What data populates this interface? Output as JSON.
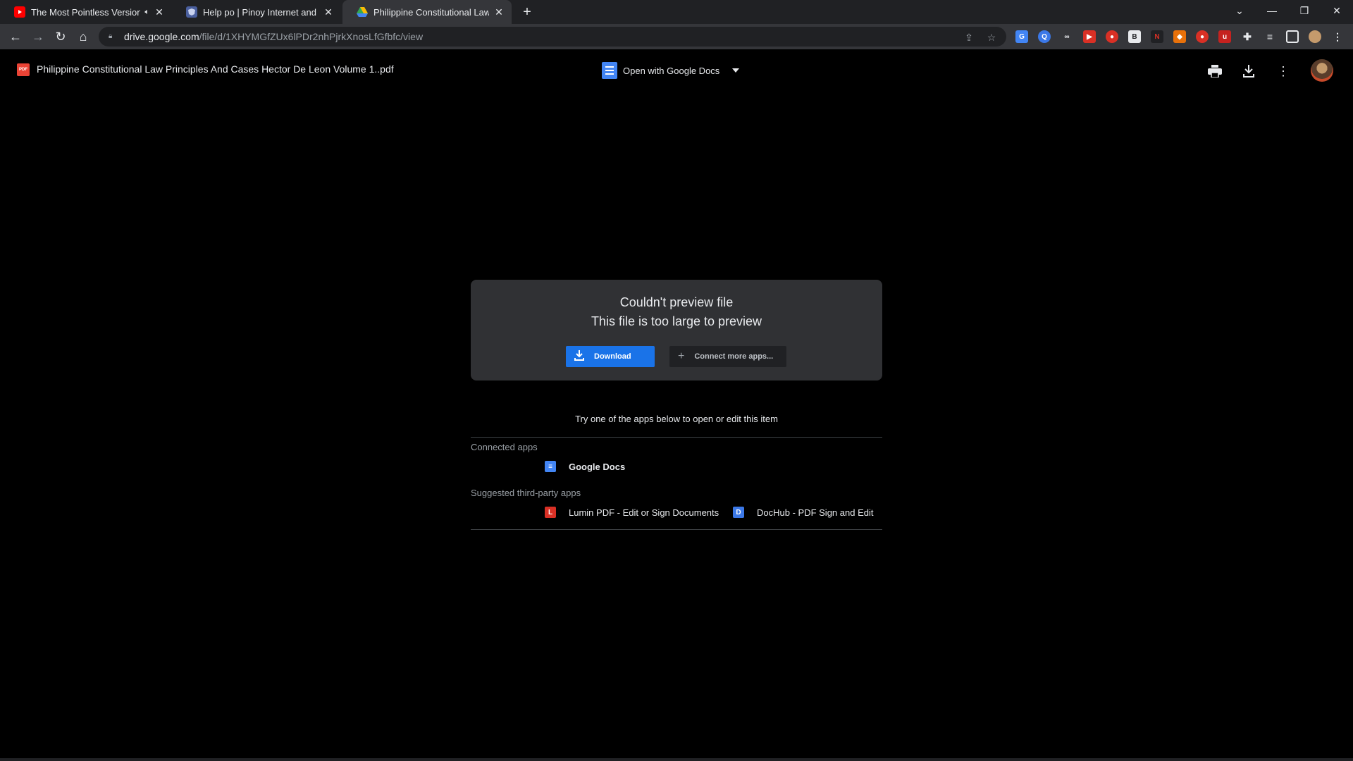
{
  "browser": {
    "tabs": [
      {
        "title": "The Most Pointless Version o",
        "favicon": "youtube-icon",
        "audio": true,
        "active": false
      },
      {
        "title": "Help po | Pinoy Internet and Tec",
        "favicon": "forum-icon",
        "audio": false,
        "active": false
      },
      {
        "title": "Philippine Constitutional Law Prin",
        "favicon": "google-drive-icon",
        "audio": false,
        "active": true
      }
    ],
    "url_host": "drive.google.com",
    "url_path": "/file/d/1XHYMGfZUx6lPDr2nhPjrkXnosLfGfbfc/view"
  },
  "viewer": {
    "file_title": "Philippine Constitutional Law Principles And Cases Hector De Leon Volume 1..pdf",
    "file_badge": "PDF",
    "open_with_label": "Open with Google Docs"
  },
  "error_card": {
    "line1": "Couldn't preview file",
    "line2": "This file is too large to preview",
    "download_label": "Download",
    "connect_label": "Connect more apps..."
  },
  "apps": {
    "hint": "Try one of the apps below to open or edit this item",
    "connected_label": "Connected apps",
    "connected": [
      {
        "name": "Google Docs"
      }
    ],
    "suggested_label": "Suggested third-party apps",
    "suggested": [
      {
        "name": "Lumin PDF - Edit or Sign Documents"
      },
      {
        "name": "DocHub - PDF Sign and Edit"
      }
    ]
  },
  "colors": {
    "background": "#000000",
    "card": "#303134",
    "accent_blue": "#1a73e8",
    "pdf_red": "#ea4335"
  }
}
